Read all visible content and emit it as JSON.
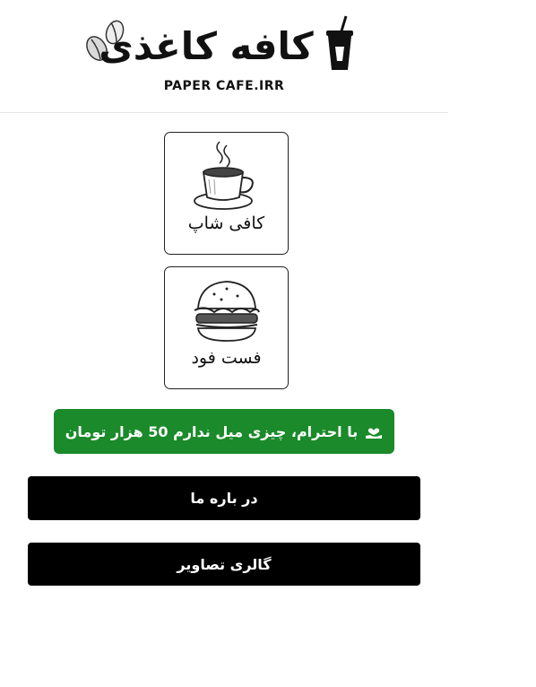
{
  "header": {
    "logo_title": "کافه کاغذی",
    "logo_subtitle": "PAPER CAFE.IRR"
  },
  "categories": [
    {
      "label": "کافی شاپ",
      "icon": "coffee-cup-icon"
    },
    {
      "label": "فست فود",
      "icon": "burger-icon"
    }
  ],
  "actions": {
    "donate_label": "با احترام، چیزی میل ندارم 50 هزار تومان",
    "donate_icon": "hand-heart-icon",
    "about_label": "در باره ما",
    "gallery_label": "گالری تصاویر"
  },
  "colors": {
    "donate_button": "#1a8a2a",
    "nav_button": "#000000"
  }
}
